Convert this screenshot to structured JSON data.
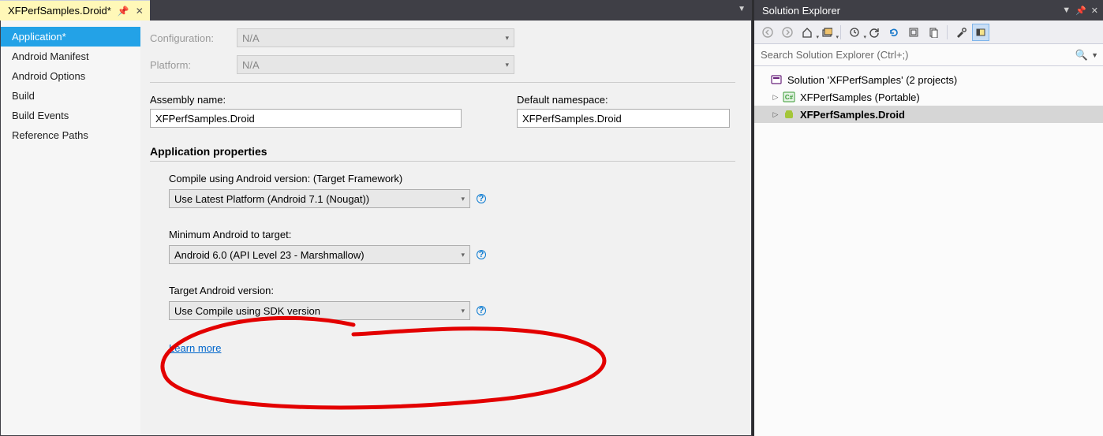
{
  "tab": {
    "title": "XFPerfSamples.Droid*"
  },
  "sidebar": {
    "items": [
      {
        "label": "Application*"
      },
      {
        "label": "Android Manifest"
      },
      {
        "label": "Android Options"
      },
      {
        "label": "Build"
      },
      {
        "label": "Build Events"
      },
      {
        "label": "Reference Paths"
      }
    ]
  },
  "config": {
    "label": "Configuration:",
    "value": "N/A",
    "platform_label": "Platform:",
    "platform_value": "N/A"
  },
  "fields": {
    "assembly_label": "Assembly name:",
    "assembly_value": "XFPerfSamples.Droid",
    "namespace_label": "Default namespace:",
    "namespace_value": "XFPerfSamples.Droid"
  },
  "appprops": {
    "title": "Application properties",
    "compile_label": "Compile using Android version:  (Target Framework)",
    "compile_value": "Use Latest Platform (Android 7.1 (Nougat))",
    "min_label": "Minimum Android to target:",
    "min_value": "Android 6.0 (API Level 23 - Marshmallow)",
    "target_label": "Target Android version:",
    "target_value": "Use Compile using SDK version",
    "learn": "Learn more"
  },
  "sx": {
    "title": "Solution Explorer",
    "search_placeholder": "Search Solution Explorer (Ctrl+;)",
    "tree": [
      {
        "label": "Solution 'XFPerfSamples' (2 projects)",
        "kind": "sln",
        "indent": 0,
        "expander": "",
        "bold": false,
        "selected": false
      },
      {
        "label": "XFPerfSamples (Portable)",
        "kind": "cs",
        "indent": 1,
        "expander": "▷",
        "bold": false,
        "selected": false
      },
      {
        "label": "XFPerfSamples.Droid",
        "kind": "droid",
        "indent": 1,
        "expander": "▷",
        "bold": true,
        "selected": true
      }
    ],
    "icons": {
      "back": "back-icon",
      "fwd": "forward-icon",
      "home": "home-icon",
      "sync": "sync-icon",
      "history": "history-icon",
      "undo": "undo-icon",
      "refresh": "refresh-icon",
      "collapse": "collapse-icon",
      "copy": "copy-icon",
      "props": "properties-icon",
      "showall": "show-all-icon"
    }
  }
}
